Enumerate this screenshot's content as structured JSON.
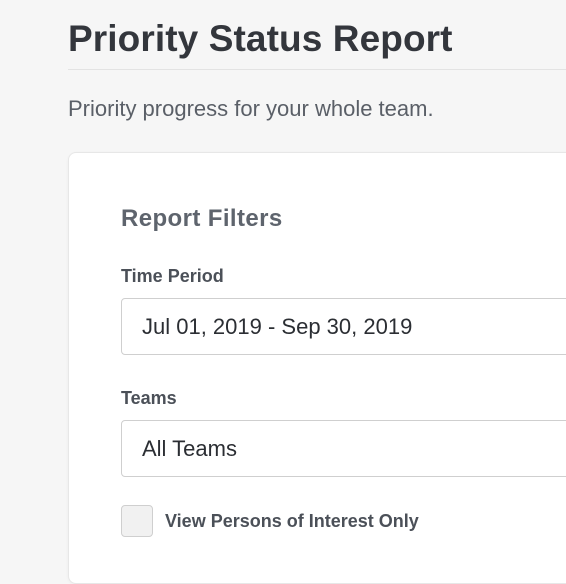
{
  "header": {
    "title": "Priority Status Report",
    "subtitle": "Priority progress for your whole team."
  },
  "filters": {
    "section_title": "Report Filters",
    "time_period": {
      "label": "Time Period",
      "value": "Jul 01, 2019 - Sep 30, 2019"
    },
    "teams": {
      "label": "Teams",
      "value": "All Teams"
    },
    "persons_of_interest": {
      "label": "View Persons of Interest Only",
      "checked": false
    }
  }
}
